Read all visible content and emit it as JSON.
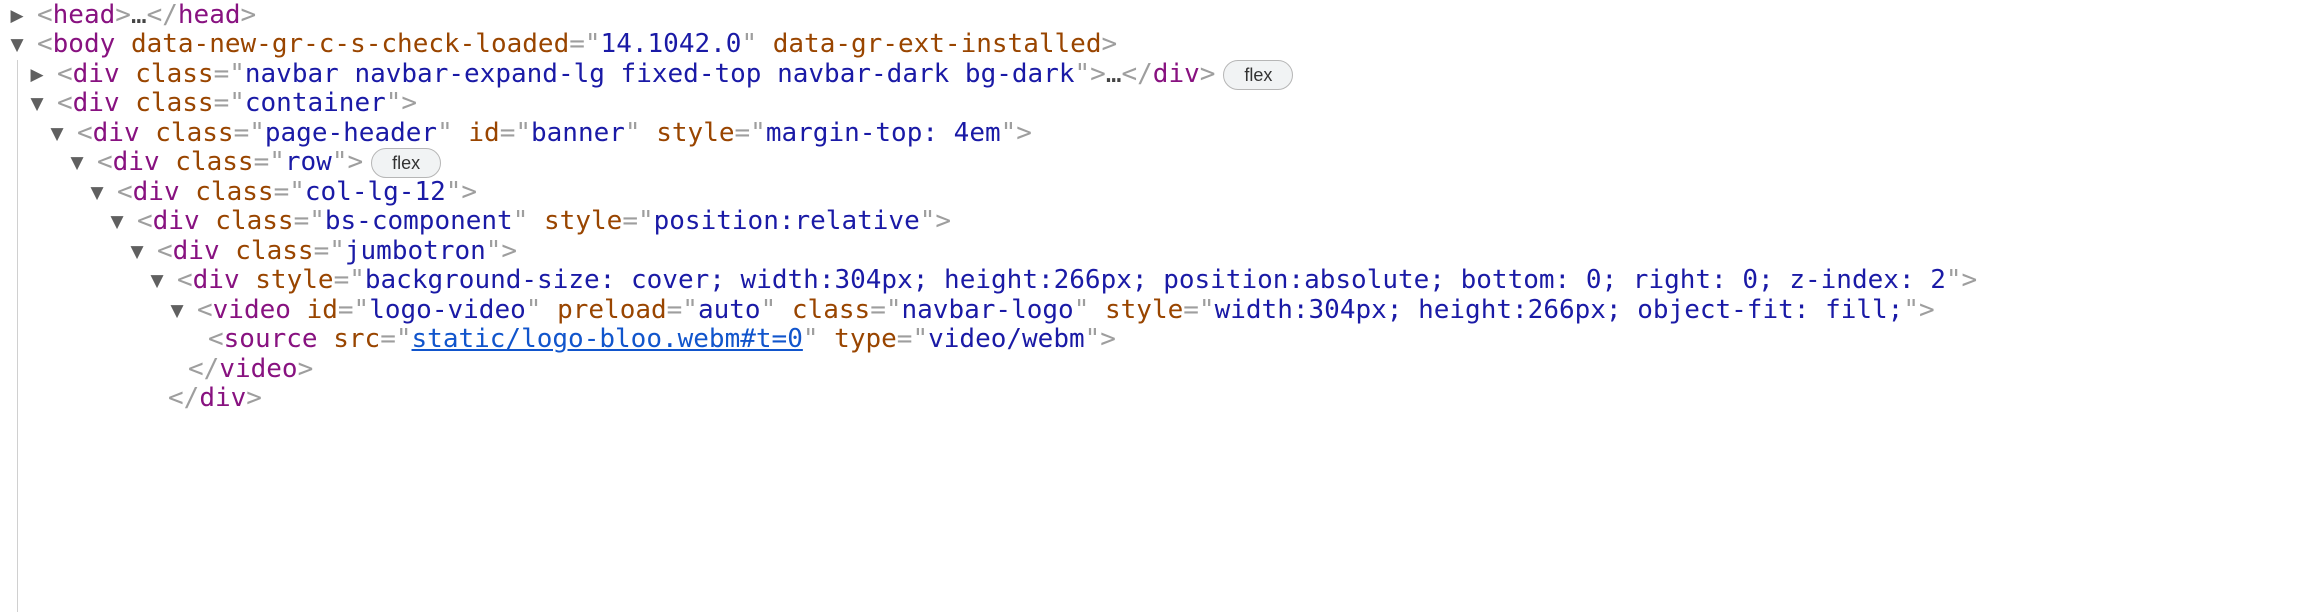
{
  "glyphs": {
    "open": "▼",
    "closed": "▶",
    "ellipsis": "…"
  },
  "nodes": {
    "head": {
      "tag": "head"
    },
    "body": {
      "tag": "body",
      "attrs": [
        {
          "name": "data-new-gr-c-s-check-loaded",
          "value": "14.1042.0"
        },
        {
          "name": "data-gr-ext-installed"
        }
      ]
    },
    "navbar": {
      "tag": "div",
      "attrs": [
        {
          "name": "class",
          "value": "navbar navbar-expand-lg fixed-top navbar-dark bg-dark"
        }
      ],
      "badge": "flex"
    },
    "container": {
      "tag": "div",
      "attrs": [
        {
          "name": "class",
          "value": "container"
        }
      ]
    },
    "page_header": {
      "tag": "div",
      "attrs": [
        {
          "name": "class",
          "value": "page-header"
        },
        {
          "name": "id",
          "value": "banner"
        },
        {
          "name": "style",
          "value": "margin-top: 4em"
        }
      ]
    },
    "row": {
      "tag": "div",
      "attrs": [
        {
          "name": "class",
          "value": "row"
        }
      ],
      "badge": "flex"
    },
    "col": {
      "tag": "div",
      "attrs": [
        {
          "name": "class",
          "value": "col-lg-12"
        }
      ]
    },
    "bs_component": {
      "tag": "div",
      "attrs": [
        {
          "name": "class",
          "value": "bs-component"
        },
        {
          "name": "style",
          "value": "position:relative"
        }
      ]
    },
    "jumbotron": {
      "tag": "div",
      "attrs": [
        {
          "name": "class",
          "value": "jumbotron"
        }
      ]
    },
    "styled_div": {
      "tag": "div",
      "attrs": [
        {
          "name": "style",
          "value": "background-size: cover; width:304px; height:266px; position:absolute; bottom: 0; right: 0; z-index: 2"
        }
      ]
    },
    "video": {
      "tag": "video",
      "attrs": [
        {
          "name": "id",
          "value": "logo-video"
        },
        {
          "name": "preload",
          "value": "auto"
        },
        {
          "name": "class",
          "value": "navbar-logo"
        },
        {
          "name": "style",
          "value": "width:304px; height:266px; object-fit: fill;"
        }
      ]
    },
    "source": {
      "tag": "source",
      "attrs": [
        {
          "name": "src",
          "value": "static/logo-bloo.webm#t=0"
        },
        {
          "name": "type",
          "value": "video/webm"
        }
      ]
    },
    "video_close": {
      "tag": "video"
    },
    "div_close": {
      "tag": "div"
    }
  }
}
